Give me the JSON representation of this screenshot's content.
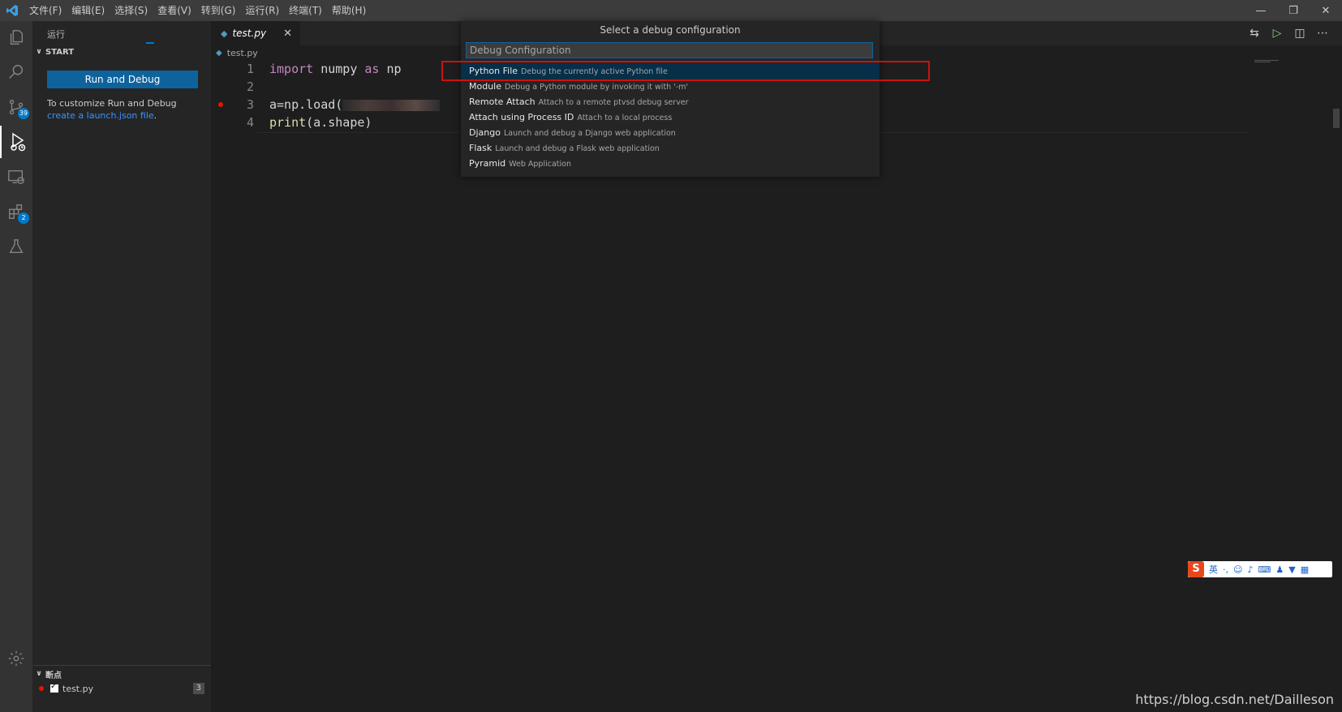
{
  "menu": [
    "文件(F)",
    "编辑(E)",
    "选择(S)",
    "查看(V)",
    "转到(G)",
    "运行(R)",
    "终端(T)",
    "帮助(H)"
  ],
  "window_controls": {
    "minimize": "—",
    "restore": "❐",
    "close": "✕"
  },
  "activity_bar": {
    "items": [
      "explorer-icon",
      "search-icon",
      "source-control-icon",
      "run-debug-icon",
      "remote-explorer-icon",
      "extensions-icon",
      "testing-icon",
      "settings-gear-icon"
    ],
    "source_control_badge": "39",
    "extensions_badge": "2"
  },
  "sidebar": {
    "title": "运行",
    "start_section": "START",
    "run_button": "Run and Debug",
    "customize_text": "To customize Run and Debug ",
    "create_link": "create a launch.json file",
    "customize_suffix": ".",
    "breakpoints_section": "断点",
    "breakpoint_file": "test.py",
    "breakpoint_count": "3"
  },
  "editor": {
    "tab_name": "test.py",
    "breadcrumb": "test.py",
    "lines": [
      {
        "num": "1",
        "parts": [
          [
            "kw",
            "import"
          ],
          [
            "t",
            " numpy "
          ],
          [
            "kw",
            "as"
          ],
          [
            "t",
            " np"
          ]
        ]
      },
      {
        "num": "2",
        "parts": []
      },
      {
        "num": "3",
        "parts": [
          [
            "t",
            "a=np.load("
          ]
        ],
        "breakpoint": true,
        "redacted": true
      },
      {
        "num": "4",
        "parts": [
          [
            "fn",
            "print"
          ],
          [
            "t",
            "(a.shape)"
          ]
        ]
      }
    ]
  },
  "quick_pick": {
    "title": "Select a debug configuration",
    "placeholder": "Debug Configuration",
    "items": [
      {
        "label": "Python File",
        "desc": "Debug the currently active Python file",
        "selected": true
      },
      {
        "label": "Module",
        "desc": "Debug a Python module by invoking it with '-m'"
      },
      {
        "label": "Remote Attach",
        "desc": "Attach to a remote ptvsd debug server"
      },
      {
        "label": "Attach using Process ID",
        "desc": "Attach to a local process"
      },
      {
        "label": "Django",
        "desc": "Launch and debug a Django web application"
      },
      {
        "label": "Flask",
        "desc": "Launch and debug a Flask web application"
      },
      {
        "label": "Pyramid",
        "desc": "Web Application"
      }
    ]
  },
  "ime_toolbar": {
    "logo": "S",
    "mode": "英"
  },
  "watermark": "https://blog.csdn.net/Dailleson",
  "colors": {
    "accent": "#007acc",
    "button": "#0e639c",
    "breakpoint": "#e51400",
    "highlight_box": "#cc1111"
  }
}
